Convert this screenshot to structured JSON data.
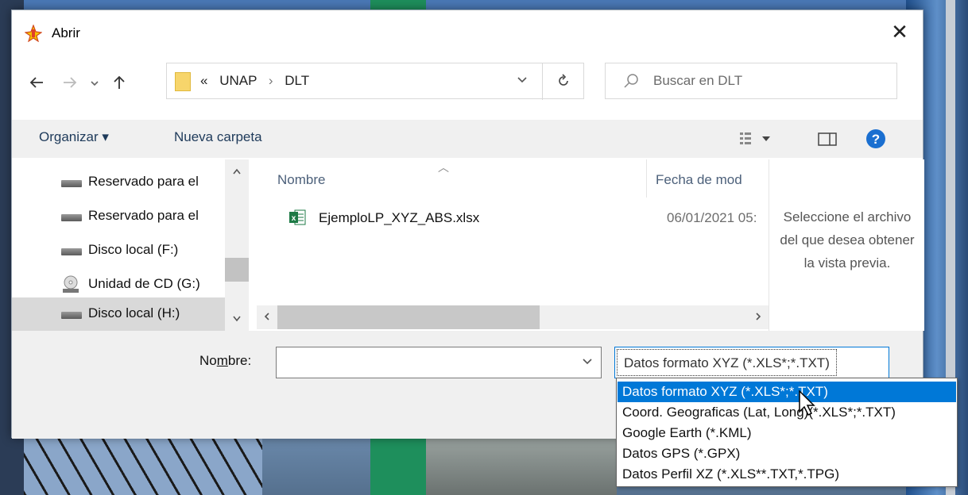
{
  "dialog": {
    "title": "Abrir",
    "close_label": "✕"
  },
  "address": {
    "overflow": "«",
    "crumbs": [
      "UNAP",
      "DLT"
    ],
    "separator": "›"
  },
  "search": {
    "placeholder": "Buscar en DLT"
  },
  "toolbar": {
    "organize_label": "Organizar ▾",
    "new_folder_label": "Nueva carpeta"
  },
  "nav_pane": {
    "items": [
      {
        "label": "Reservado para el",
        "icon": "drive-icon"
      },
      {
        "label": "Reservado para el",
        "icon": "drive-icon"
      },
      {
        "label": "Disco local (F:)",
        "icon": "drive-icon"
      },
      {
        "label": "Unidad de CD (G:)",
        "icon": "cd-drive-icon"
      },
      {
        "label": "Disco local (H:)",
        "icon": "drive-icon",
        "selected": true
      }
    ]
  },
  "file_list": {
    "columns": [
      "Nombre",
      "Fecha de mod"
    ],
    "files": [
      {
        "name": "EjemploLP_XYZ_ABS.xlsx",
        "date": "06/01/2021 05:",
        "icon": "excel-icon"
      }
    ]
  },
  "preview": {
    "text": "Seleccione el archivo del que desea obtener la vista previa."
  },
  "bottom": {
    "name_label_prefix": "No",
    "name_label_mnemonic": "m",
    "name_label_suffix": "bre:",
    "name_value": "",
    "filter_value": "Datos formato XYZ  (*.XLS*;*.TXT)"
  },
  "filter_options": [
    {
      "label": "Datos formato XYZ  (*.XLS*;*.TXT)",
      "selected": true
    },
    {
      "label": "Coord. Geograficas (Lat, Long)(*.XLS*;*.TXT)"
    },
    {
      "label": "Google Earth (*.KML)"
    },
    {
      "label": "Datos GPS  (*.GPX)"
    },
    {
      "label": "Datos Perfil  XZ (*.XLS**.TXT,*.TPG)"
    }
  ],
  "colors": {
    "accent": "#0078d7",
    "help": "#1a6fd0",
    "excel": "#1d7a45",
    "folder": "#f7d56b"
  }
}
